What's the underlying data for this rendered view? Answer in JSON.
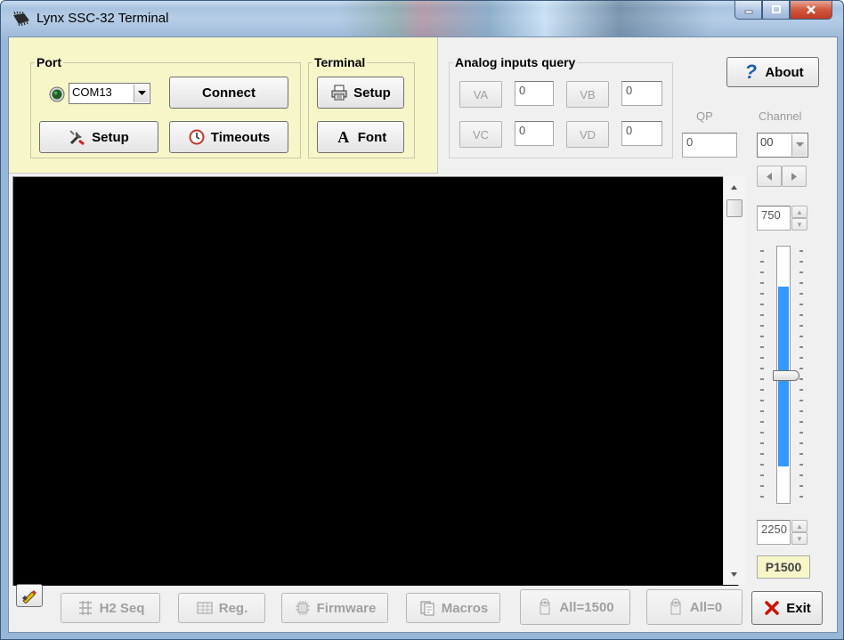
{
  "window": {
    "title": "Lynx SSC-32 Terminal"
  },
  "port": {
    "legend": "Port",
    "com_value": "COM13",
    "connect_label": "Connect",
    "setup_label": "Setup",
    "timeouts_label": "Timeouts"
  },
  "terminal_group": {
    "legend": "Terminal",
    "setup_label": "Setup",
    "font_label": "Font"
  },
  "analog": {
    "legend": "Analog inputs query",
    "va_label": "VA",
    "va_value": "0",
    "vb_label": "VB",
    "vb_value": "0",
    "vc_label": "VC",
    "vc_value": "0",
    "vd_label": "VD",
    "vd_value": "0"
  },
  "about_label": "About",
  "qp": {
    "label": "QP",
    "value": "0"
  },
  "channel": {
    "label": "Channel",
    "value": "00",
    "min_value": "750",
    "max_value": "2250",
    "position_label": "P1500",
    "slider_position_fraction": 0.5
  },
  "bottom": {
    "h2seq_label": "H2 Seq",
    "reg_label": "Reg.",
    "firmware_label": "Firmware",
    "macros_label": "Macros",
    "all1500_label": "All=1500",
    "all0_label": "All=0",
    "exit_label": "Exit"
  },
  "colors": {
    "terminal_bg": "#000000",
    "panel_yellow": "#f7f6c9",
    "slider_fill": "#3399ff",
    "exit_x": "#cc1100",
    "about_q": "#1a5fb4"
  }
}
